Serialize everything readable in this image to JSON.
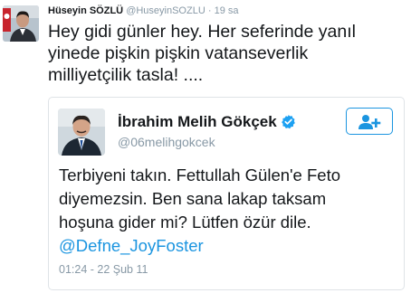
{
  "tweet": {
    "author": {
      "name": "Hüseyin SÖZLÜ",
      "handle": "@HuseyinSOZLU",
      "separator": "·",
      "time": "19 sa"
    },
    "text": "Hey gidi günler hey. Her seferinde yanıl\nyinede pişkin pişkin vatanseverlik\nmilliyetçilik tasla! ...."
  },
  "quoted_tweet": {
    "author": {
      "name": "İbrahim Melih Gökçek",
      "handle": "@06melihgokcek",
      "verified_icon": "verified-badge-icon"
    },
    "follow_icon": "add-user-icon",
    "text": "Terbiyeni takın. Fettullah Gülen'e Feto\ndiyemezsin. Ben sana lakap taksam\nhoşuna gider mi? Lütfen özür dile.",
    "mention": "@Defne_JoyFoster",
    "timestamp": "01:24 - 22 Şub 11"
  },
  "colors": {
    "link_blue": "#1b95e0",
    "verified_blue": "#1da1f2",
    "secondary_gray": "#8899a6",
    "text_dark": "#14171a",
    "border_gray": "#dfe3e7"
  }
}
